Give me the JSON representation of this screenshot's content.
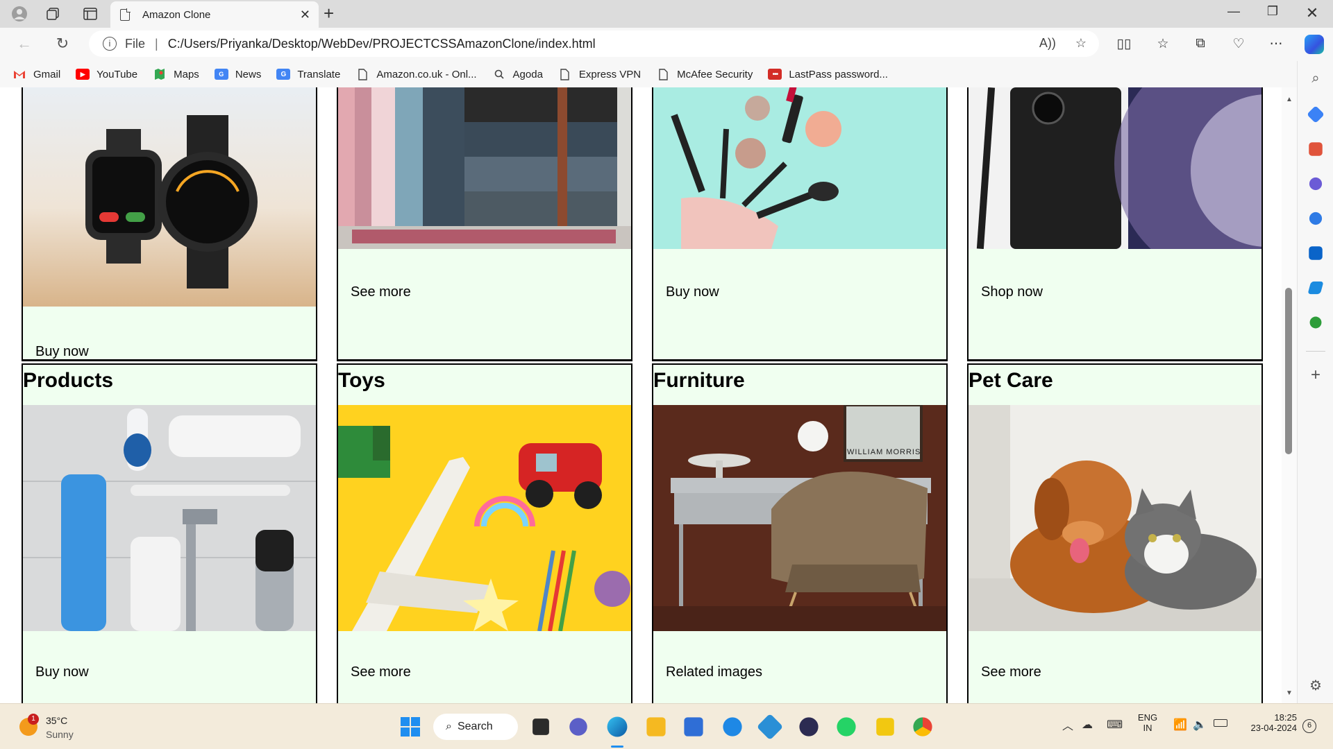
{
  "tab": {
    "title": "Amazon Clone"
  },
  "address": {
    "scheme_label": "File",
    "url": "C:/Users/Priyanka/Desktop/WebDev/PROJECTCSSAmazonClone/index.html"
  },
  "bookmarks": [
    {
      "label": "Gmail",
      "icon": "gmail-icon",
      "color": "#ea4335"
    },
    {
      "label": "YouTube",
      "icon": "youtube-icon",
      "color": "#ff0000"
    },
    {
      "label": "Maps",
      "icon": "maps-icon",
      "color": "#34a853"
    },
    {
      "label": "News",
      "icon": "news-icon",
      "color": "#4285f4"
    },
    {
      "label": "Translate",
      "icon": "translate-icon",
      "color": "#4285f4"
    },
    {
      "label": "Amazon.co.uk - Onl...",
      "icon": "document-icon",
      "color": "#444444"
    },
    {
      "label": "Agoda",
      "icon": "agoda-icon",
      "color": "#444444"
    },
    {
      "label": "Express VPN",
      "icon": "document-icon",
      "color": "#444444"
    },
    {
      "label": "McAfee Security",
      "icon": "document-icon",
      "color": "#444444"
    },
    {
      "label": "LastPass password...",
      "icon": "lastpass-icon",
      "color": "#d32d27"
    }
  ],
  "cards_top": [
    {
      "link": "Buy now",
      "image": "smartwatches-image"
    },
    {
      "link": "See more",
      "image": "clothing-rack-image"
    },
    {
      "link": "Buy now",
      "image": "makeup-brushes-image"
    },
    {
      "link": "Shop now",
      "image": "smartphone-image"
    }
  ],
  "cards_bottom": [
    {
      "title": "Products",
      "link": "Buy now",
      "image": "personal-care-image"
    },
    {
      "title": "Toys",
      "link": "See more",
      "image": "toys-image"
    },
    {
      "title": "Furniture",
      "link": "Related images",
      "image": "desk-chair-image",
      "print": "WILLIAM MORRIS"
    },
    {
      "title": "Pet Care",
      "link": "See more",
      "image": "dog-cat-image"
    }
  ],
  "taskbar": {
    "weather": {
      "temp": "35°C",
      "condition": "Sunny",
      "badge": "1"
    },
    "search_label": "Search",
    "language": {
      "line1": "ENG",
      "line2": "IN"
    },
    "time": "18:25",
    "date": "23-04-2024",
    "notifications": "6"
  },
  "colors": {
    "card_bg": "#f0fff0",
    "card_border": "#000000",
    "taskbar_bg": "#f3ebdb"
  }
}
